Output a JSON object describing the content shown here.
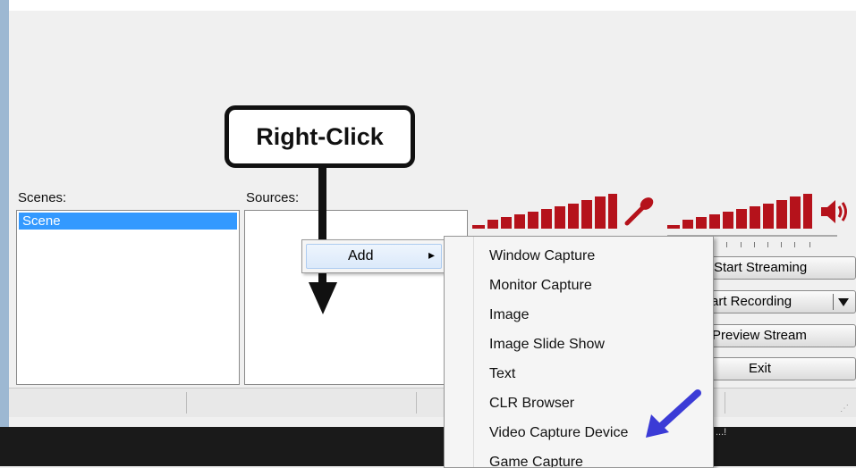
{
  "callout": {
    "text": "Right-Click"
  },
  "scenes": {
    "label": "Scenes:",
    "items": [
      "Scene"
    ]
  },
  "sources": {
    "label": "Sources:"
  },
  "context_menu": {
    "add_label": "Add",
    "arrow": "▸"
  },
  "submenu": {
    "items": [
      "Window Capture",
      "Monitor Capture",
      "Image",
      "Image Slide Show",
      "Text",
      "CLR Browser",
      "Video Capture Device",
      "Game Capture"
    ]
  },
  "buttons": {
    "start_streaming": "Start Streaming",
    "start_recording": "art Recording",
    "preview_stream": "Preview Stream",
    "exit": "Exit"
  },
  "bottom": {
    "partial_text": "...!"
  },
  "colors": {
    "meter": "#b5121b",
    "selection": "#3399ff",
    "annotation_arrow": "#3b3bd6"
  },
  "icons": {
    "mic": "microphone-icon",
    "speaker": "speaker-icon"
  }
}
